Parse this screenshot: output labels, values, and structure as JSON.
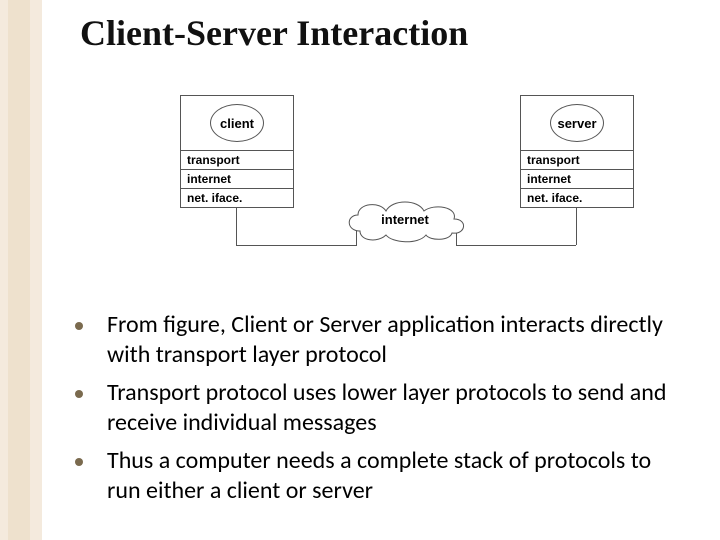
{
  "title": "Client-Server Interaction",
  "diagram": {
    "client_label": "client",
    "server_label": "server",
    "layers": {
      "transport": "transport",
      "internet": "internet",
      "netiface": "net. iface."
    },
    "cloud_label": "internet"
  },
  "bullets": [
    "From figure, Client or Server application interacts directly with transport layer protocol",
    "Transport protocol uses lower layer protocols to send and receive individual messages",
    "Thus a computer needs a complete stack of protocols to run either a client or server"
  ]
}
